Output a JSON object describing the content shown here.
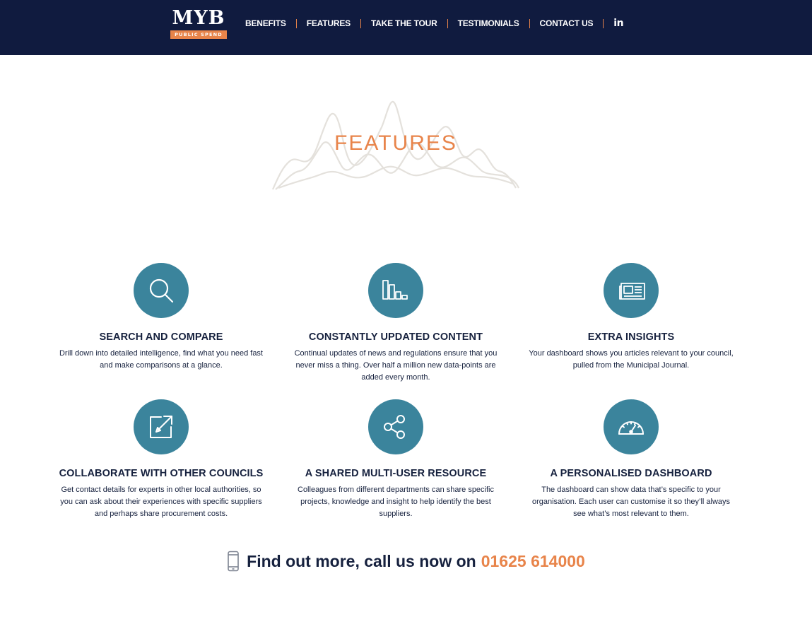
{
  "brand": {
    "name": "MYB",
    "tagline": "PUBLIC SPEND",
    "accent": "#e8844a",
    "navy": "#101b3f",
    "teal": "#3b849c"
  },
  "nav": {
    "items": [
      {
        "label": "BENEFITS"
      },
      {
        "label": "FEATURES"
      },
      {
        "label": "TAKE THE TOUR"
      },
      {
        "label": "TESTIMONIALS"
      },
      {
        "label": "CONTACT US"
      }
    ],
    "linkedin_label": "in",
    "linkedin_icon": "linkedin-icon"
  },
  "section": {
    "title": "FEATURES"
  },
  "features": [
    {
      "icon": "search-icon",
      "title": "SEARCH AND COMPARE",
      "text": "Drill down into detailed intelligence, find what you need fast and make comparisons at a glance."
    },
    {
      "icon": "bar-chart-icon",
      "title": "CONSTANTLY UPDATED CONTENT",
      "text": "Continual updates of news and regulations ensure that you never miss a thing. Over half a million new data-points are added every month."
    },
    {
      "icon": "newspaper-icon",
      "title": "EXTRA INSIGHTS",
      "text": "Your dashboard shows you articles relevant to your council, pulled from the Municipal Journal."
    },
    {
      "icon": "edit-external-icon",
      "title": "COLLABORATE WITH OTHER COUNCILS",
      "text": "Get contact details for experts in other local authorities, so you can ask about their experiences with specific suppliers and perhaps share procurement costs."
    },
    {
      "icon": "share-icon",
      "title": "A SHARED MULTI-USER RESOURCE",
      "text": "Colleagues from different departments can share specific projects, knowledge and insight to help identify the best suppliers."
    },
    {
      "icon": "gauge-icon",
      "title": "A PERSONALISED DASHBOARD",
      "text": "The dashboard can show data that’s specific to your organisation. Each user can customise it so they’ll always see what’s most relevant to them."
    }
  ],
  "cta": {
    "icon": "mobile-phone-icon",
    "text": "Find out more, call us now on",
    "phone": "01625 614000"
  }
}
